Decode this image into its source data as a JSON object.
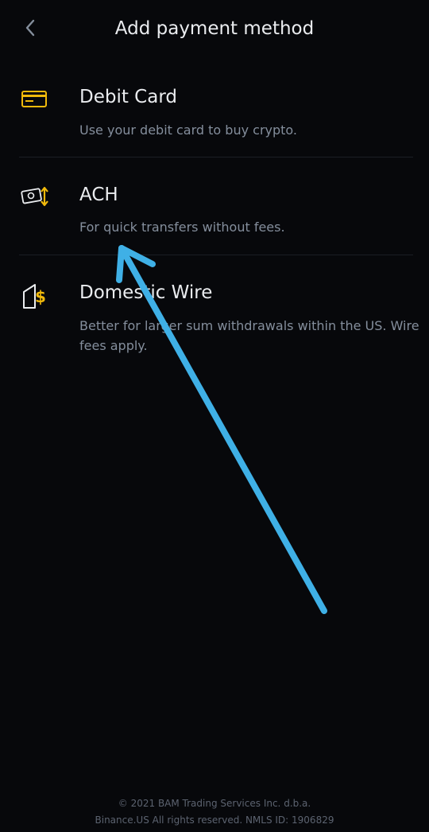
{
  "header": {
    "title": "Add payment method",
    "back_icon": "chevron-left-icon"
  },
  "methods": [
    {
      "name": "Debit Card",
      "description": "Use your debit card to buy crypto.",
      "icon": "debit-card-icon"
    },
    {
      "name": "ACH",
      "description": "For quick transfers without fees.",
      "icon": "ach-transfer-icon"
    },
    {
      "name": "Domestic Wire",
      "description": "Better for larger sum withdrawals within the US. Wire fees apply.",
      "icon": "wire-dollar-icon"
    }
  ],
  "annotation": {
    "icon": "arrow-annotation-icon",
    "color": "#3fb0e6"
  },
  "footer": {
    "line1": "© 2021 BAM Trading Services Inc. d.b.a.",
    "line2": "Binance.US All rights reserved. NMLS ID: 1906829"
  },
  "colors": {
    "background": "#07080b",
    "accent": "#f0b90b",
    "text_primary": "#eaecef",
    "text_secondary": "#848e9c"
  }
}
